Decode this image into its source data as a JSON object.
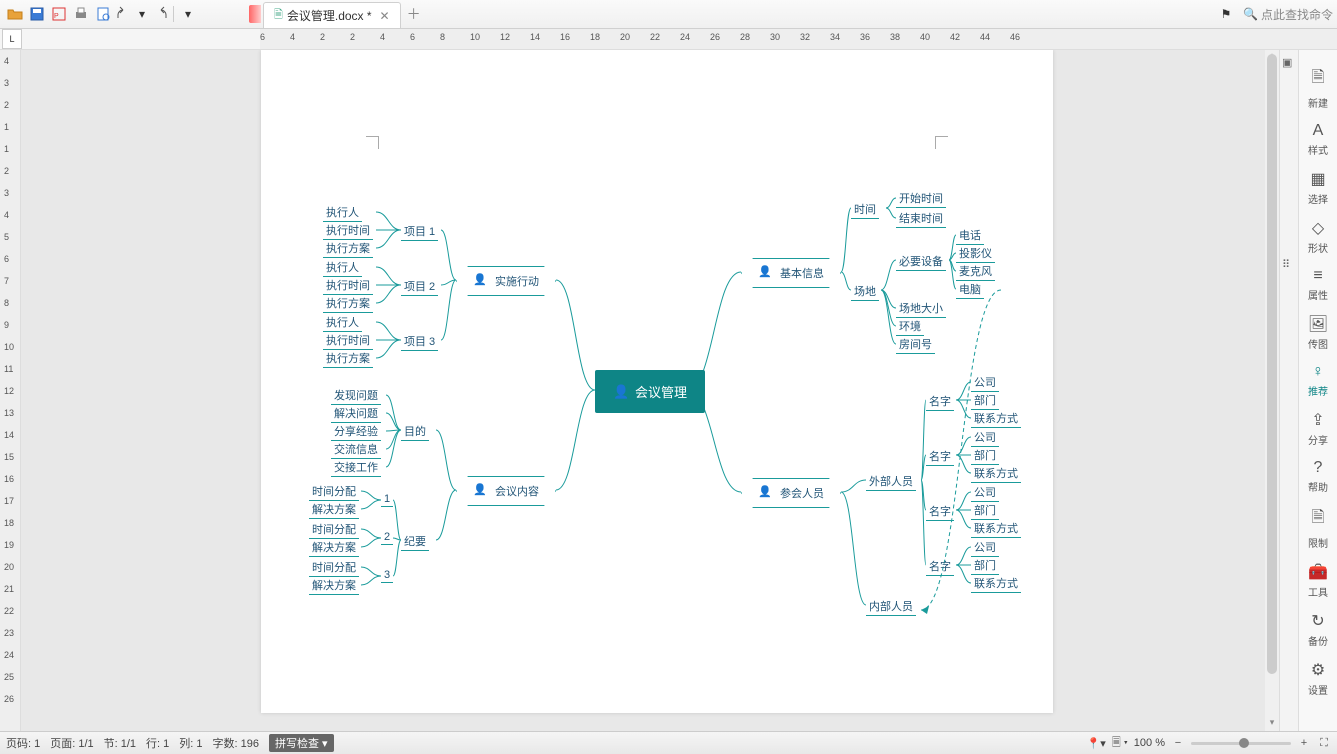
{
  "toolbar": {
    "search_placeholder": "点此查找命令"
  },
  "tab": {
    "filename": "会议管理.docx *"
  },
  "ruler_h": [
    6,
    4,
    2,
    2,
    4,
    6,
    8,
    10,
    12,
    14,
    16,
    18,
    20,
    22,
    24,
    26,
    28,
    30,
    32,
    34,
    36,
    38,
    40,
    42,
    44,
    46
  ],
  "ruler_v": [
    4,
    3,
    2,
    1,
    1,
    2,
    3,
    4,
    5,
    6,
    7,
    8,
    9,
    10,
    11,
    12,
    13,
    14,
    15,
    16,
    17,
    18,
    19,
    20,
    21,
    22,
    23,
    24,
    25,
    26
  ],
  "mind": {
    "center": "会议管理",
    "left": [
      {
        "label": "实施行动",
        "children": [
          {
            "label": "项目 1",
            "children": [
              {
                "label": "执行人"
              },
              {
                "label": "执行时间"
              },
              {
                "label": "执行方案"
              }
            ]
          },
          {
            "label": "项目 2",
            "children": [
              {
                "label": "执行人"
              },
              {
                "label": "执行时间"
              },
              {
                "label": "执行方案"
              }
            ]
          },
          {
            "label": "项目 3",
            "children": [
              {
                "label": "执行人"
              },
              {
                "label": "执行时间"
              },
              {
                "label": "执行方案"
              }
            ]
          }
        ]
      },
      {
        "label": "会议内容",
        "children": [
          {
            "label": "目的",
            "children": [
              {
                "label": "发现问题"
              },
              {
                "label": "解决问题"
              },
              {
                "label": "分享经验"
              },
              {
                "label": "交流信息"
              },
              {
                "label": "交接工作"
              }
            ]
          },
          {
            "label": "纪要",
            "children": [
              {
                "label": "1",
                "children": [
                  {
                    "label": "时间分配"
                  },
                  {
                    "label": "解决方案"
                  }
                ]
              },
              {
                "label": "2",
                "children": [
                  {
                    "label": "时间分配"
                  },
                  {
                    "label": "解决方案"
                  }
                ]
              },
              {
                "label": "3",
                "children": [
                  {
                    "label": "时间分配"
                  },
                  {
                    "label": "解决方案"
                  }
                ]
              }
            ]
          }
        ]
      }
    ],
    "right": [
      {
        "label": "基本信息",
        "children": [
          {
            "label": "时间",
            "children": [
              {
                "label": "开始时间"
              },
              {
                "label": "结束时间"
              }
            ]
          },
          {
            "label": "场地",
            "children": [
              {
                "label": "必要设备",
                "children": [
                  {
                    "label": "电话"
                  },
                  {
                    "label": "投影仪"
                  },
                  {
                    "label": "麦克风"
                  },
                  {
                    "label": "电脑"
                  }
                ]
              },
              {
                "label": "场地大小"
              },
              {
                "label": "环境"
              },
              {
                "label": "房间号"
              }
            ]
          }
        ]
      },
      {
        "label": "参会人员",
        "children": [
          {
            "label": "外部人员",
            "children": [
              {
                "label": "名字",
                "children": [
                  {
                    "label": "公司"
                  },
                  {
                    "label": "部门"
                  },
                  {
                    "label": "联系方式"
                  }
                ]
              },
              {
                "label": "名字",
                "children": [
                  {
                    "label": "公司"
                  },
                  {
                    "label": "部门"
                  },
                  {
                    "label": "联系方式"
                  }
                ]
              },
              {
                "label": "名字",
                "children": [
                  {
                    "label": "公司"
                  },
                  {
                    "label": "部门"
                  },
                  {
                    "label": "联系方式"
                  }
                ]
              },
              {
                "label": "名字",
                "children": [
                  {
                    "label": "公司"
                  },
                  {
                    "label": "部门"
                  },
                  {
                    "label": "联系方式"
                  }
                ]
              }
            ]
          },
          {
            "label": "内部人员"
          }
        ]
      }
    ]
  },
  "rpanel": [
    {
      "icon": "🗎",
      "label": "新建"
    },
    {
      "icon": "A",
      "label": "样式"
    },
    {
      "icon": "▦",
      "label": "选择"
    },
    {
      "icon": "◇",
      "label": "形状"
    },
    {
      "icon": "≡",
      "label": "属性"
    },
    {
      "icon": "🖼",
      "label": "传图"
    },
    {
      "icon": "♀",
      "label": "推荐",
      "active": true
    },
    {
      "icon": "⇪",
      "label": "分享"
    },
    {
      "icon": "?",
      "label": "帮助"
    },
    {
      "icon": "🗎",
      "label": "限制"
    },
    {
      "icon": "🧰",
      "label": "工具"
    },
    {
      "icon": "↻",
      "label": "备份"
    },
    {
      "icon": "⚙",
      "label": "设置"
    }
  ],
  "status": {
    "page_no": "页码: 1",
    "page": "页面: 1/1",
    "sec": "节: 1/1",
    "row": "行: 1",
    "col": "列: 1",
    "words": "字数: 196",
    "spell": "拼写检查",
    "zoom": "100 %"
  }
}
